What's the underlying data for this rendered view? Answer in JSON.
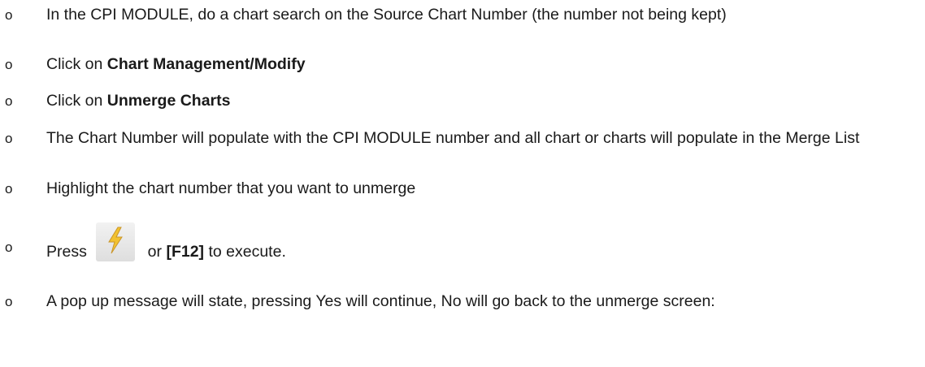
{
  "steps": [
    {
      "pre": "In the CPI MODULE, do a chart search on the Source Chart Number (the number not being kept)",
      "bold": "",
      "post": ""
    },
    {
      "pre": "Click on ",
      "bold": "Chart Management/Modify",
      "post": ""
    },
    {
      "pre": "Click on ",
      "bold": "Unmerge Charts",
      "post": ""
    },
    {
      "pre": "The Chart Number will populate with the CPI MODULE number and all chart or charts will populate in the Merge List",
      "bold": "",
      "post": ""
    },
    {
      "pre": "Highlight the chart number that you want to unmerge",
      "bold": "",
      "post": ""
    },
    {
      "pre": "Press ",
      "icon": "lightning-bolt-icon",
      "mid": " or ",
      "bold": "[F12]",
      "post": " to execute."
    },
    {
      "pre": "A pop up message will state, pressing Yes will continue, No will go back to the unmerge screen:",
      "bold": "",
      "post": ""
    }
  ],
  "bullet_char": "o",
  "colors": {
    "text": "#1a1a1a",
    "icon_bolt": "#f2c230",
    "icon_bg": "#e8e8e8"
  }
}
